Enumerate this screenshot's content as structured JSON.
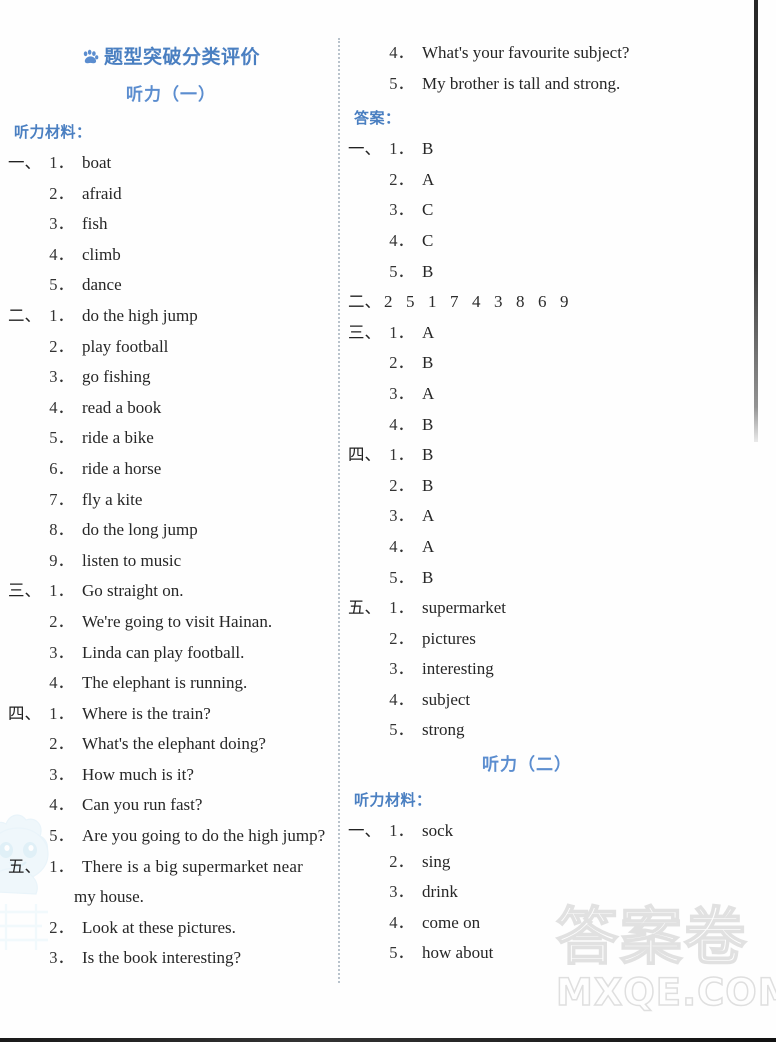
{
  "watermarks": {
    "brand_cn": "答案卷",
    "brand_en": "MXQE.COM"
  },
  "left_column": {
    "header": {
      "icon": "paw-print-icon",
      "title": "题型突破分类评价",
      "subtitle": "听力（一）"
    },
    "section_label": "听力材料：",
    "groups": [
      {
        "cn_num": "一、",
        "items": [
          {
            "n": "1．",
            "text": "boat"
          },
          {
            "n": "2．",
            "text": "afraid"
          },
          {
            "n": "3．",
            "text": "fish"
          },
          {
            "n": "4．",
            "text": "climb"
          },
          {
            "n": "5．",
            "text": "dance"
          }
        ]
      },
      {
        "cn_num": "二、",
        "items": [
          {
            "n": "1．",
            "text": "do the high jump"
          },
          {
            "n": "2．",
            "text": "play football"
          },
          {
            "n": "3．",
            "text": "go fishing"
          },
          {
            "n": "4．",
            "text": "read a book"
          },
          {
            "n": "5．",
            "text": "ride a bike"
          },
          {
            "n": "6．",
            "text": "ride a horse"
          },
          {
            "n": "7．",
            "text": "fly a kite"
          },
          {
            "n": "8．",
            "text": "do the long jump"
          },
          {
            "n": "9．",
            "text": "listen to music"
          }
        ]
      },
      {
        "cn_num": "三、",
        "items": [
          {
            "n": "1．",
            "text": "Go straight on."
          },
          {
            "n": "2．",
            "text": "We're going to visit Hainan."
          },
          {
            "n": "3．",
            "text": "Linda can play football."
          },
          {
            "n": "4．",
            "text": "The elephant is running."
          }
        ]
      },
      {
        "cn_num": "四、",
        "items": [
          {
            "n": "1．",
            "text": "Where is the train?"
          },
          {
            "n": "2．",
            "text": "What's the elephant doing?"
          },
          {
            "n": "3．",
            "text": "How much is it?"
          },
          {
            "n": "4．",
            "text": "Can you run fast?"
          },
          {
            "n": "5．",
            "text": "Are you going to do the high jump?"
          }
        ]
      },
      {
        "cn_num": "五、",
        "items": [
          {
            "n": "1．",
            "text": "There is a big supermarket near",
            "cont": "my house."
          },
          {
            "n": "2．",
            "text": "Look at these pictures."
          },
          {
            "n": "3．",
            "text": "Is the book interesting?"
          }
        ]
      }
    ]
  },
  "right_column": {
    "continued_items": [
      {
        "n": "4．",
        "text": "What's your favourite subject?"
      },
      {
        "n": "5．",
        "text": "My brother is tall and strong."
      }
    ],
    "answers_label": "答案：",
    "answer_groups": [
      {
        "cn_num": "一、",
        "items": [
          {
            "n": "1．",
            "text": "B"
          },
          {
            "n": "2．",
            "text": "A"
          },
          {
            "n": "3．",
            "text": "C"
          },
          {
            "n": "4．",
            "text": "C"
          },
          {
            "n": "5．",
            "text": "B"
          }
        ]
      },
      {
        "cn_num": "二、",
        "digits": [
          "2",
          "5",
          "1",
          "7",
          "4",
          "3",
          "8",
          "6",
          "9"
        ]
      },
      {
        "cn_num": "三、",
        "items": [
          {
            "n": "1．",
            "text": "A"
          },
          {
            "n": "2．",
            "text": "B"
          },
          {
            "n": "3．",
            "text": "A"
          },
          {
            "n": "4．",
            "text": "B"
          }
        ]
      },
      {
        "cn_num": "四、",
        "items": [
          {
            "n": "1．",
            "text": "B"
          },
          {
            "n": "2．",
            "text": "B"
          },
          {
            "n": "3．",
            "text": "A"
          },
          {
            "n": "4．",
            "text": "A"
          },
          {
            "n": "5．",
            "text": "B"
          }
        ]
      },
      {
        "cn_num": "五、",
        "items": [
          {
            "n": "1．",
            "text": "supermarket"
          },
          {
            "n": "2．",
            "text": "pictures"
          },
          {
            "n": "3．",
            "text": "interesting"
          },
          {
            "n": "4．",
            "text": "subject"
          },
          {
            "n": "5．",
            "text": "strong"
          }
        ]
      }
    ],
    "second_heading": "听力（二）",
    "second_section_label": "听力材料：",
    "second_groups": [
      {
        "cn_num": "一、",
        "items": [
          {
            "n": "1．",
            "text": "sock"
          },
          {
            "n": "2．",
            "text": "sing"
          },
          {
            "n": "3．",
            "text": "drink"
          },
          {
            "n": "4．",
            "text": "come on"
          },
          {
            "n": "5．",
            "text": "how about"
          }
        ]
      }
    ]
  },
  "colors": {
    "heading_blue": "#4a7fc1",
    "subheading_blue": "#5b8dcf",
    "body_text": "#262626"
  }
}
